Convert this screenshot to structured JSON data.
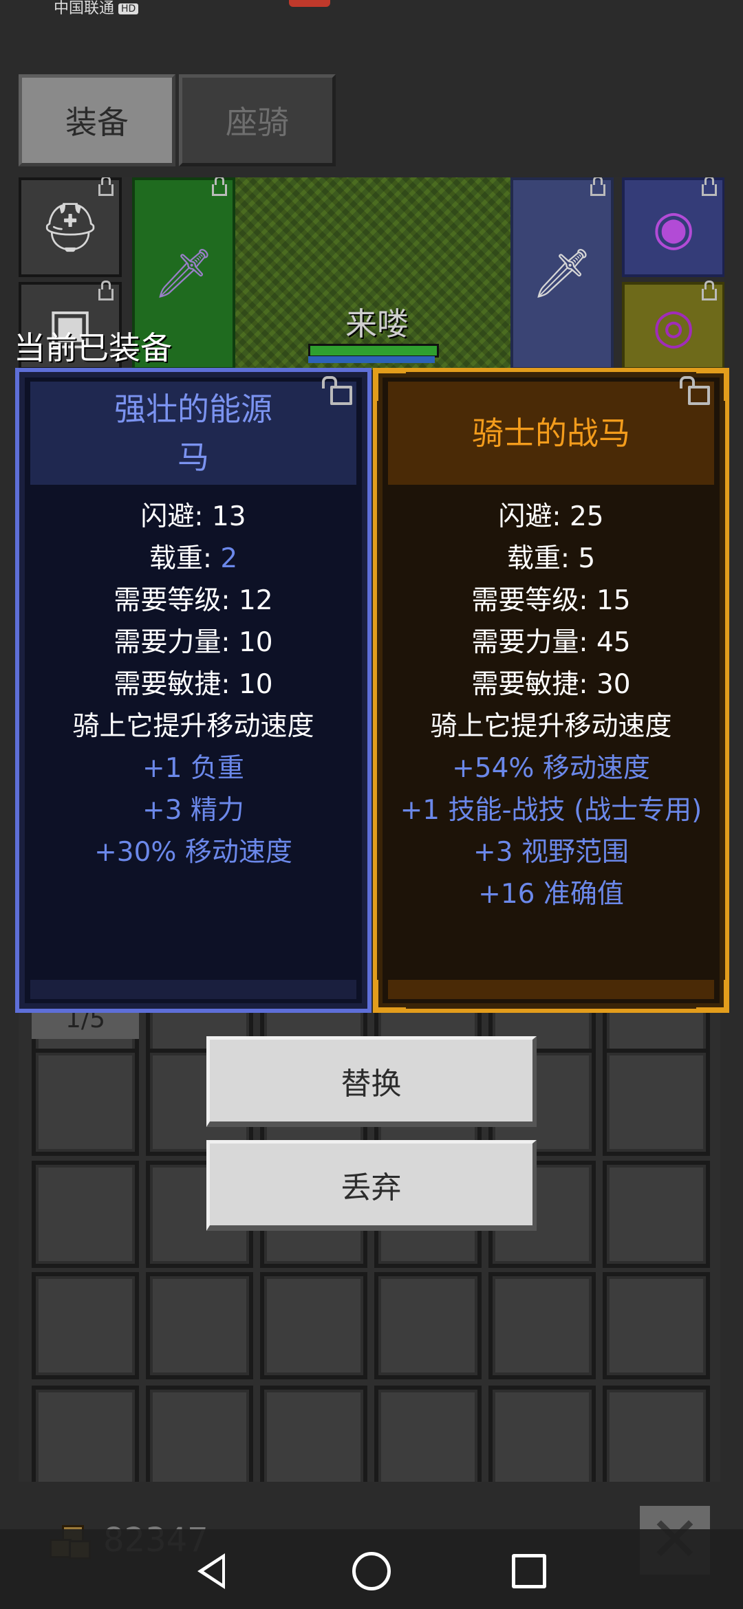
{
  "status_bar": {
    "carrier": "中国联通",
    "hd": "HD"
  },
  "tabs": [
    {
      "label": "装备",
      "active": true
    },
    {
      "label": "座骑",
      "active": false
    }
  ],
  "scene": {
    "character_name": "来喽"
  },
  "current_equipped_label": "当前已装备",
  "equipped_item": {
    "name": "强壮的能源马",
    "rarity_color": "#7b93f0",
    "stats": [
      {
        "label": "闪避: ",
        "value": "13"
      },
      {
        "label": "载重: ",
        "value": "2"
      },
      {
        "label": "需要等级: ",
        "value": "12"
      },
      {
        "label": "需要力量: ",
        "value": "10"
      },
      {
        "label": "需要敏捷: ",
        "value": "10"
      }
    ],
    "description": "骑上它提升移动速度",
    "bonuses": [
      "+1 负重",
      "+3 精力",
      "+30% 移动速度"
    ]
  },
  "new_item": {
    "name": "骑士的战马",
    "rarity_color": "#f39c1c",
    "stats": [
      {
        "label": "闪避: ",
        "value": "25"
      },
      {
        "label": "载重: ",
        "value": "5"
      },
      {
        "label": "需要等级: ",
        "value": "15"
      },
      {
        "label": "需要力量: ",
        "value": "45"
      },
      {
        "label": "需要敏捷: ",
        "value": "30"
      }
    ],
    "description": "骑上它提升移动速度",
    "bonuses": [
      "+54% 移动速度",
      "+1 技能-战技 (战士专用)",
      "+3 视野范围",
      "+16 准确值"
    ]
  },
  "inventory": {
    "count": "1/5"
  },
  "actions": {
    "replace": "替换",
    "discard": "丢弃"
  },
  "gold": {
    "amount": "82347"
  },
  "close": {
    "symbol": "✕"
  },
  "colors": {
    "equipped_border": "#5e6fd8",
    "new_border": "#e39d1c",
    "bonus_text": "#6b88ea"
  }
}
